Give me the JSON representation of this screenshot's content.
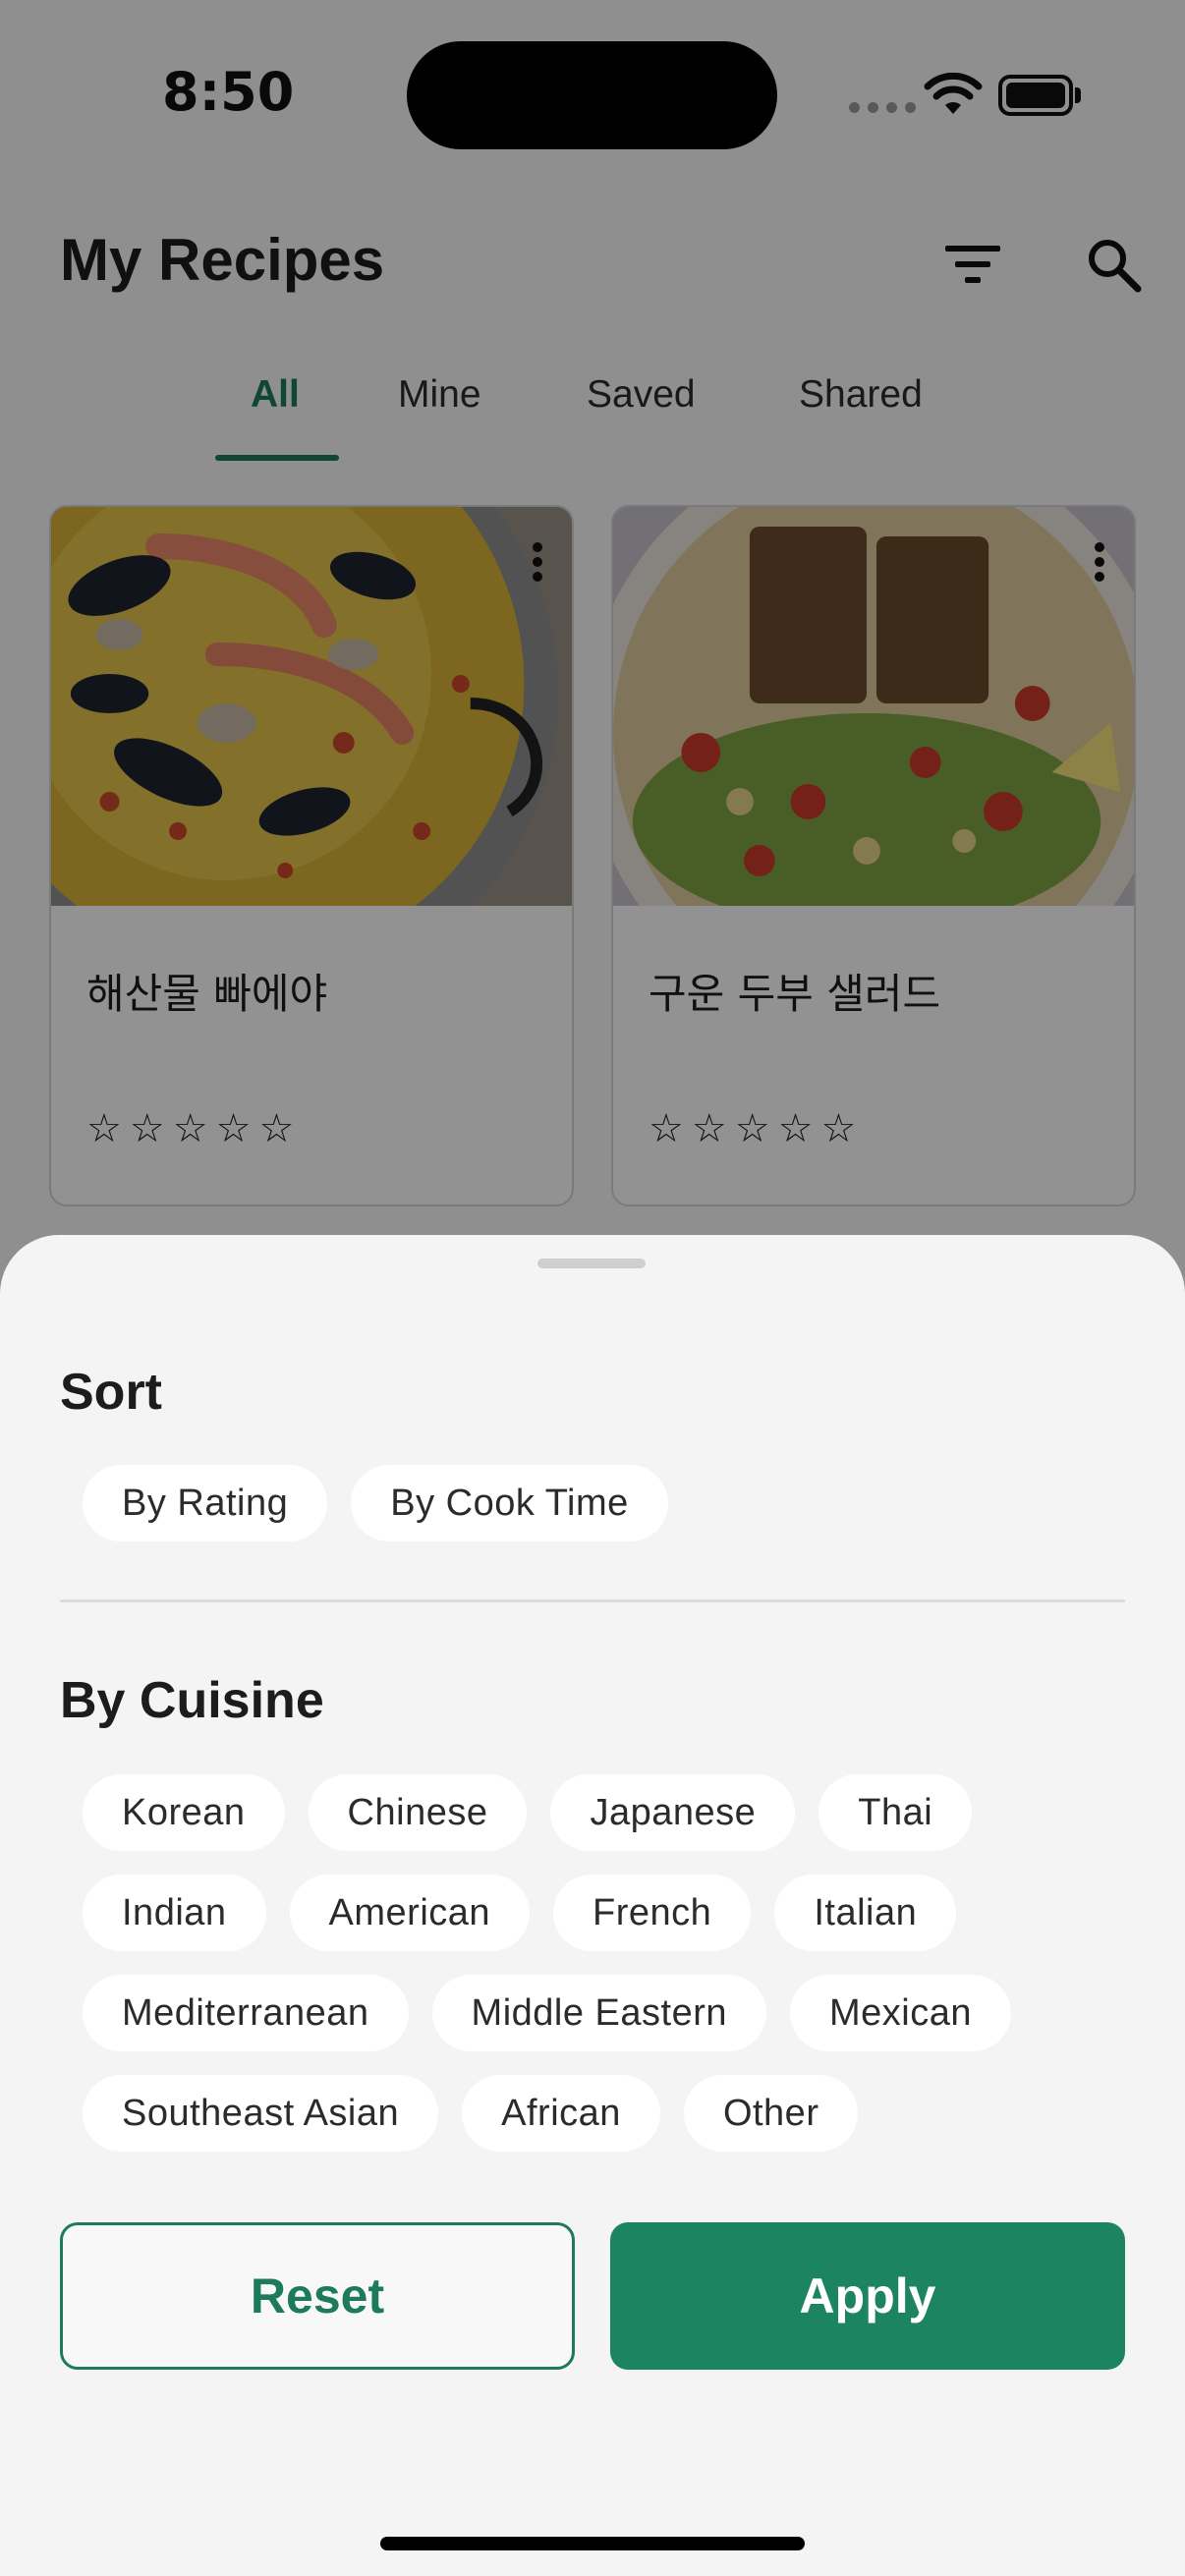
{
  "status_bar": {
    "time": "8:50"
  },
  "header": {
    "title": "My Recipes",
    "filter_icon": "filter-icon",
    "search_icon": "search-icon"
  },
  "tabs": [
    {
      "label": "All",
      "active": true
    },
    {
      "label": "Mine",
      "active": false
    },
    {
      "label": "Saved",
      "active": false
    },
    {
      "label": "Shared",
      "active": false
    }
  ],
  "recipes": [
    {
      "title": "해산물 빠에야",
      "rating_stars": "☆☆☆☆☆",
      "rating": 0,
      "image": "seafood-paella-photo"
    },
    {
      "title": "구운 두부 샐러드",
      "rating_stars": "☆☆☆☆☆",
      "rating": 0,
      "image": "grilled-tofu-salad-photo"
    }
  ],
  "filter_sheet": {
    "sort": {
      "title": "Sort",
      "options": [
        "By Rating",
        "By Cook Time"
      ]
    },
    "cuisine": {
      "title": "By Cuisine",
      "rows": [
        [
          "Korean",
          "Chinese",
          "Japanese",
          "Thai"
        ],
        [
          "Indian",
          "American",
          "French",
          "Italian"
        ],
        [
          "Mediterranean",
          "Middle Eastern",
          "Mexican"
        ],
        [
          "Southeast Asian",
          "African",
          "Other"
        ]
      ]
    },
    "reset_label": "Reset",
    "apply_label": "Apply"
  },
  "colors": {
    "accent": "#1d7a5a",
    "apply_button": "#1d8462",
    "sheet_background": "#f4f4f4",
    "chip_background": "#ffffff"
  }
}
